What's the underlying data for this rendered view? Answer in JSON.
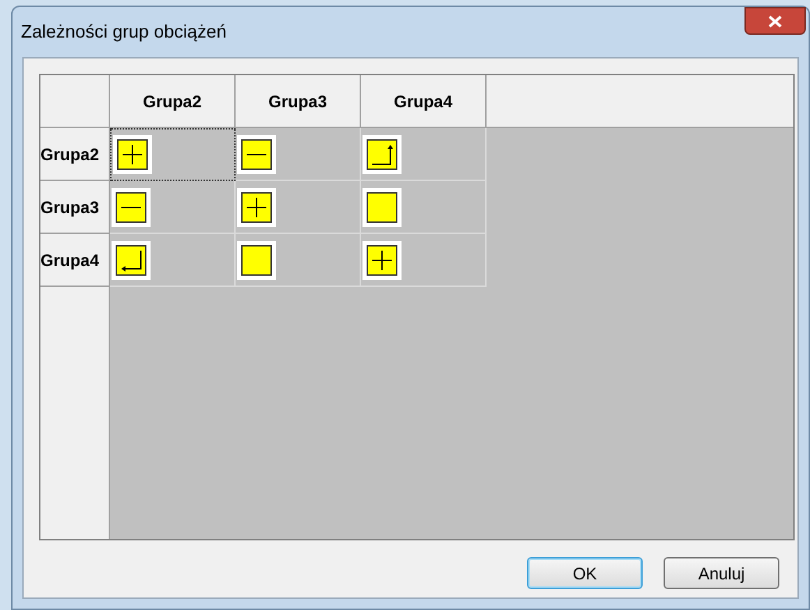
{
  "window": {
    "title": "Zależności grup obciążeń"
  },
  "grid": {
    "columns": [
      "Grupa2",
      "Grupa3",
      "Grupa4"
    ],
    "rows": [
      {
        "label": "Grupa2",
        "cells": [
          {
            "kind": "plus",
            "selected": true
          },
          {
            "kind": "minus",
            "selected": false
          },
          {
            "kind": "arrow_up",
            "selected": false
          }
        ]
      },
      {
        "label": "Grupa3",
        "cells": [
          {
            "kind": "minus",
            "selected": false
          },
          {
            "kind": "plus",
            "selected": false
          },
          {
            "kind": "empty",
            "selected": false
          }
        ]
      },
      {
        "label": "Grupa4",
        "cells": [
          {
            "kind": "arrow_down",
            "selected": false
          },
          {
            "kind": "empty",
            "selected": false
          },
          {
            "kind": "plus",
            "selected": false
          }
        ]
      }
    ]
  },
  "buttons": [
    {
      "label": "OK",
      "default": true
    },
    {
      "label": "Anuluj",
      "default": false
    }
  ]
}
